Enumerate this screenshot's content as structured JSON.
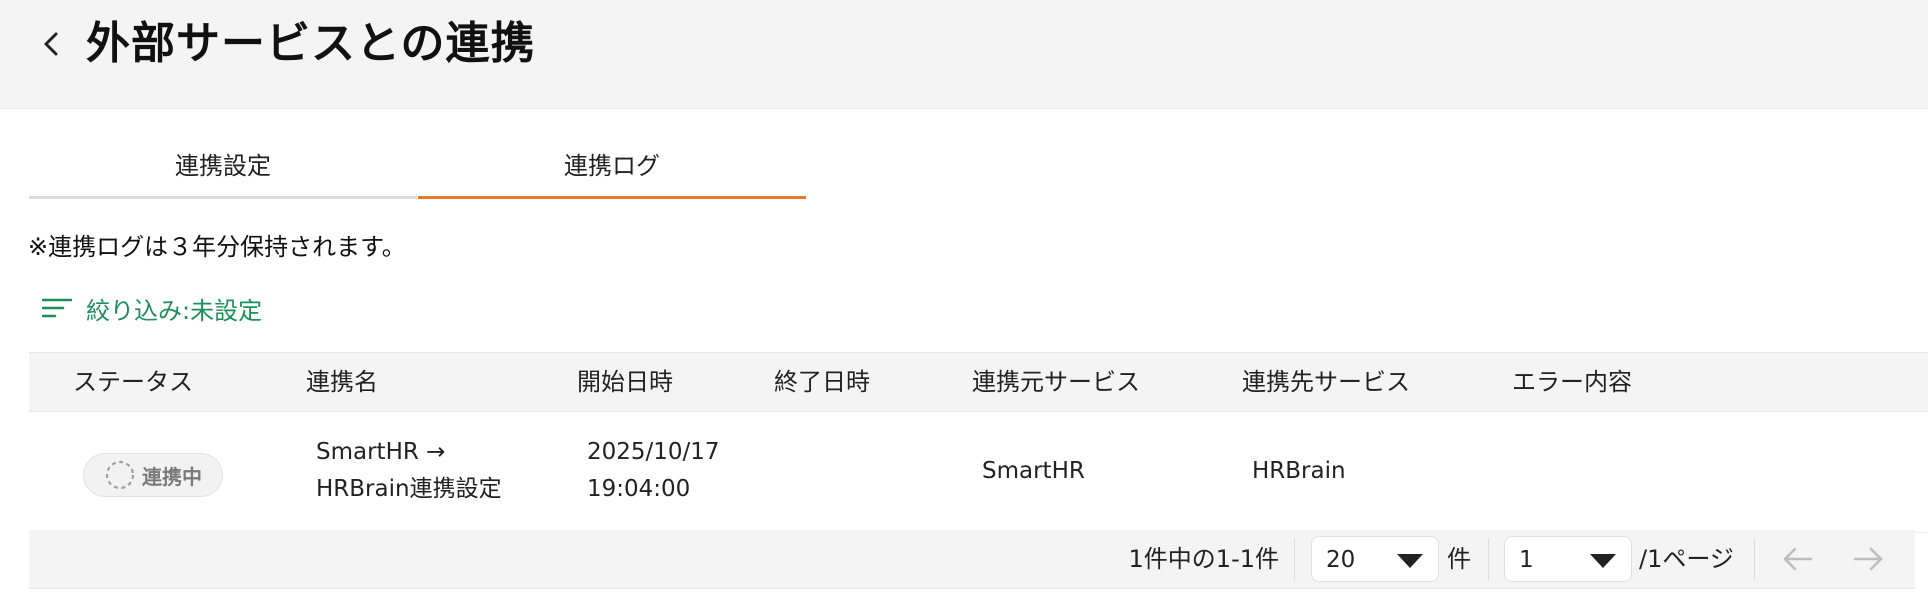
{
  "header": {
    "title": "外部サービスとの連携"
  },
  "tabs": [
    {
      "label": "連携設定",
      "active": false
    },
    {
      "label": "連携ログ",
      "active": true
    }
  ],
  "notice": "※連携ログは３年分保持されます。",
  "filter": {
    "label": "絞り込み:未設定"
  },
  "table": {
    "columns": [
      "ステータス",
      "連携名",
      "開始日時",
      "終了日時",
      "連携元サービス",
      "連携先サービス",
      "エラー内容"
    ],
    "rows": [
      {
        "status": "連携中",
        "name_line1": "SmartHR →",
        "name_line2": "HRBrain連携設定",
        "start_date": "2025/10/17",
        "start_time": "19:04:00",
        "end": "",
        "source": "SmartHR",
        "target": "HRBrain",
        "error": ""
      }
    ]
  },
  "pagination": {
    "summary": "1件中の1-1件",
    "per_page": "20",
    "per_page_unit": "件",
    "page": "1",
    "page_total": "/1ページ"
  },
  "colors": {
    "accent_tab": "#e27a2c",
    "filter_green": "#1e8f5a"
  }
}
